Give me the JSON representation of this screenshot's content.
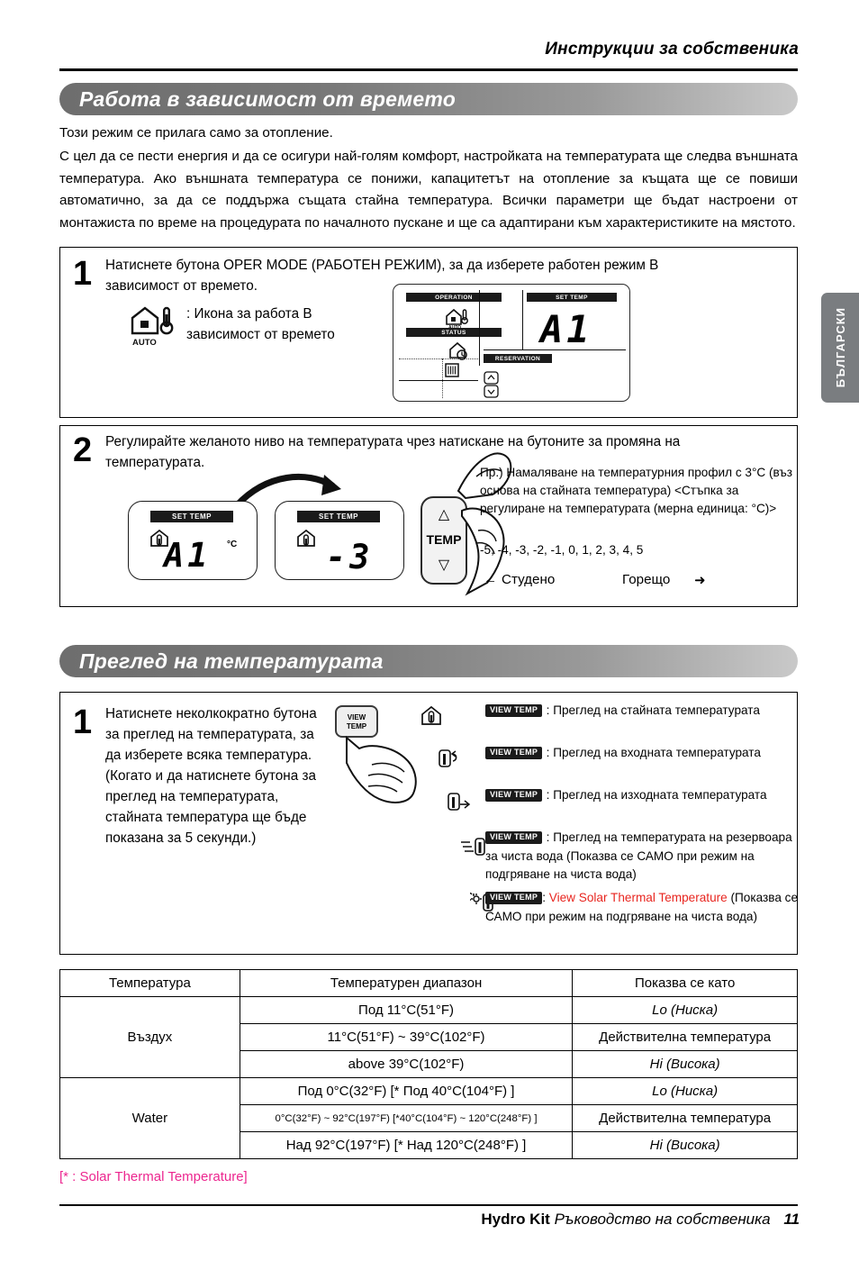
{
  "header": {
    "title": "Инструкции за собственика"
  },
  "lang_tab": {
    "label": "БЪЛГАРСКИ"
  },
  "section1": {
    "banner_title": "Работа в зависимост от времето",
    "intro1": "Този режим се прилага само за отопление.",
    "intro2": "С цел да се пести енергия и да се осигури най-голям комфорт, настройката на температурата ще следва външната температура. Ако външната температура се понижи, капацитетът на отопление за къщата ще се повиши автоматично, за да се поддържа същата стайна температура. Всички параметри ще бъдат настроени от монтажиста по време на процедурата по началното пускане и ще са адаптирани към характеристиките на мястото.",
    "step1": {
      "num": "1",
      "text": "Натиснете бутона OPER MODE (РАБОТЕН РЕЖИМ), за да изберете работен режим В зависимост от времето.",
      "icon_label": "AUTO",
      "icon_caption": ": Икона за работа В зависимост от времето",
      "lcd": {
        "operation_label": "OPERATION",
        "status_label": "STATUS",
        "set_temp_label": "SET TEMP",
        "reservation_label": "RESERVATION",
        "value": "A1",
        "auto_label": "AUTO"
      }
    },
    "step2": {
      "num": "2",
      "text": "Регулирайте желаното ниво на температурата чрез натискане на бутоните за промяна на температурата.",
      "lcd_left": {
        "tag": "SET TEMP",
        "value": "A1",
        "unit": "°C"
      },
      "lcd_right": {
        "tag": "SET TEMP",
        "value": "-3"
      },
      "button_label": "TEMP",
      "up_arrow": "△",
      "down_arrow": "▽",
      "note": "Пр.) Намаляване на температурния профил с 3°C (въз основа на стайната температура) <Стъпка за регулиране на температурата (мерна единица: °C)>",
      "note_values": "-5, -4, -3, -2, -1, 0, 1, 2, 3, 4, 5",
      "cold_label": "Студено",
      "hot_label": "Горещо",
      "cold_arrow": "←",
      "hot_arrow": "➜"
    }
  },
  "section2": {
    "banner_title": "Преглед на температурата",
    "step1": {
      "num": "1",
      "text": "Натиснете неколкократно бутона за преглед на температурата, за да изберете всяка температура.\n(Когато и да натиснете бутона за преглед на температурата, стайната температура ще бъде показана за 5 секунди.)",
      "button_label_line1": "VIEW",
      "button_label_line2": "TEMP"
    },
    "legend": [
      {
        "badge": "VIEW TEMP",
        "text": ": Преглед на стайната температурата"
      },
      {
        "badge": "VIEW TEMP",
        "text": ": Преглед на входната температурата"
      },
      {
        "badge": "VIEW TEMP",
        "text": ": Преглед на изходната температурата"
      },
      {
        "badge": "VIEW TEMP",
        "text": ": Преглед на температурата на резервоара за чиста вода (Показва се САМО при режим на подгряване на чиста вода)"
      },
      {
        "badge": "VIEW TEMP",
        "text_red": "View Solar Thermal Temperature",
        "text_rest": " (Показва се САМО при режим на подгряване на чиста вода)",
        "prefix": ": "
      }
    ]
  },
  "table": {
    "headers": [
      "Температура",
      "Температурен диапазон",
      "Показва се като"
    ],
    "rows": [
      {
        "group": "Въздух",
        "range": "Под 11°C(51°F)",
        "display": "Lo (Ниска)"
      },
      {
        "group": "",
        "range": "11°C(51°F) ~ 39°C(102°F)",
        "display": "Действителна температура"
      },
      {
        "group": "",
        "range": "above 39°C(102°F)",
        "display": "Hi (Висока)"
      },
      {
        "group": "Water",
        "range": "Под 0°C(32°F) [* Под 40°C(104°F) ]",
        "display": "Lo (Ниска)"
      },
      {
        "group": "",
        "range": "0°C(32°F) ~ 92°C(197°F) [*40°C(104°F) ~ 120°C(248°F) ]",
        "display": "Действителна температура"
      },
      {
        "group": "",
        "range": "Над 92°C(197°F) [* Над 120°C(248°F) ]",
        "display": "Hi (Висока)"
      }
    ]
  },
  "footnote": "[* : Solar Thermal Temperature]",
  "footer": {
    "product": "Hydro Kit",
    "manual": "Ръководство на собственика",
    "page": "11"
  },
  "colors": {
    "red_text": "#e8251f",
    "magenta_text": "#ec268f",
    "banner_gray": "#7a7d80"
  }
}
